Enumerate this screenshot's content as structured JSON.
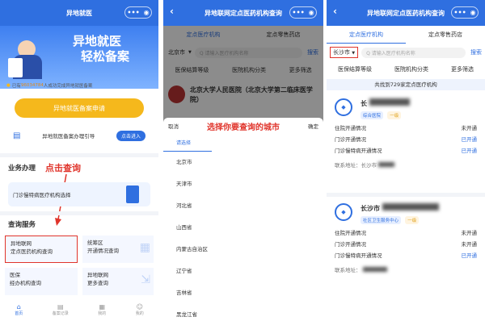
{
  "panel1": {
    "title": "异地就医",
    "banner_line1": "异地就医",
    "banner_line2": "轻松备案",
    "notice_prefix": "已有",
    "notice_count": "96034784",
    "notice_suffix": "人成功完成异地就医备案",
    "apply_button": "异地就医备案申请",
    "guide_text": "异地就医备案办理引导",
    "guide_button": "点击进入",
    "section_business": "业务办理",
    "annotation": "点击查询",
    "business_item": "门诊慢特病医疗机构选择",
    "section_query": "查询服务",
    "grid": [
      {
        "line1": "异地联网",
        "line2": "定点医药机构查询"
      },
      {
        "line1": "统筹区",
        "line2": "开通情况查询"
      },
      {
        "line1": "医保",
        "line2": "经办机构查询"
      },
      {
        "line1": "异地联网",
        "line2": "更多查询"
      }
    ],
    "bottom_nav": [
      "首页",
      "备案记录",
      "我的"
    ],
    "bottom_nav_extra": "我的"
  },
  "panel2": {
    "title": "异地联网定点医药机构查询",
    "tabs": [
      "定点医疗机构",
      "定点零售药店"
    ],
    "city_selected": "北京市",
    "search_placeholder": "Q 请输入医疗机构名称",
    "search_button": "搜索",
    "filters": [
      "医保结算等级",
      "医院机构分类",
      "更多筛选"
    ],
    "hospital_name": "北京大学人民医院（北京大学第二临床医学院）",
    "picker_cancel": "取消",
    "picker_title": "选择你要查询的城市",
    "picker_confirm": "确定",
    "picker_prompt": "请选择",
    "cities": [
      "北京市",
      "天津市",
      "河北省",
      "山西省",
      "内蒙古自治区",
      "辽宁省",
      "吉林省",
      "黑龙江省"
    ]
  },
  "panel3": {
    "title": "异地联网定点医药机构查询",
    "tabs": [
      "定点医疗机构",
      "定点零售药店"
    ],
    "city_selected": "长沙市",
    "search_placeholder": "Q 请输入医疗机构名称",
    "search_button": "搜索",
    "filters": [
      "医保结算等级",
      "医院机构分类",
      "更多筛选"
    ],
    "result_count": "共找到729家定点医疗机构",
    "hospital1": {
      "name": "长",
      "tags": [
        "综合医院",
        "一级"
      ],
      "rows": [
        {
          "label": "住院开通情况",
          "value": "未开通"
        },
        {
          "label": "门诊开通情况",
          "value": "已开通"
        },
        {
          "label": "门诊慢特病开通情况",
          "value": "已开通"
        }
      ],
      "address_label": "联系地址：长沙市"
    },
    "hospital2": {
      "name": "长沙市",
      "tags": [
        "社区卫生服务中心",
        "一级"
      ],
      "rows": [
        {
          "label": "住院开通情况",
          "value": "未开通"
        },
        {
          "label": "门诊开通情况",
          "value": "未开通"
        },
        {
          "label": "门诊慢特病开通情况",
          "value": "已开通"
        }
      ],
      "address_label": "联系地址："
    }
  },
  "colors": {
    "brand_blue": "#2f6fe0",
    "annotation_red": "#e0342b",
    "apply_yellow": "#f5b81c"
  },
  "icons": {
    "back": "chevron-left-icon",
    "capsule": "menu-dots-icon",
    "dropdown": "caret-down-icon"
  }
}
